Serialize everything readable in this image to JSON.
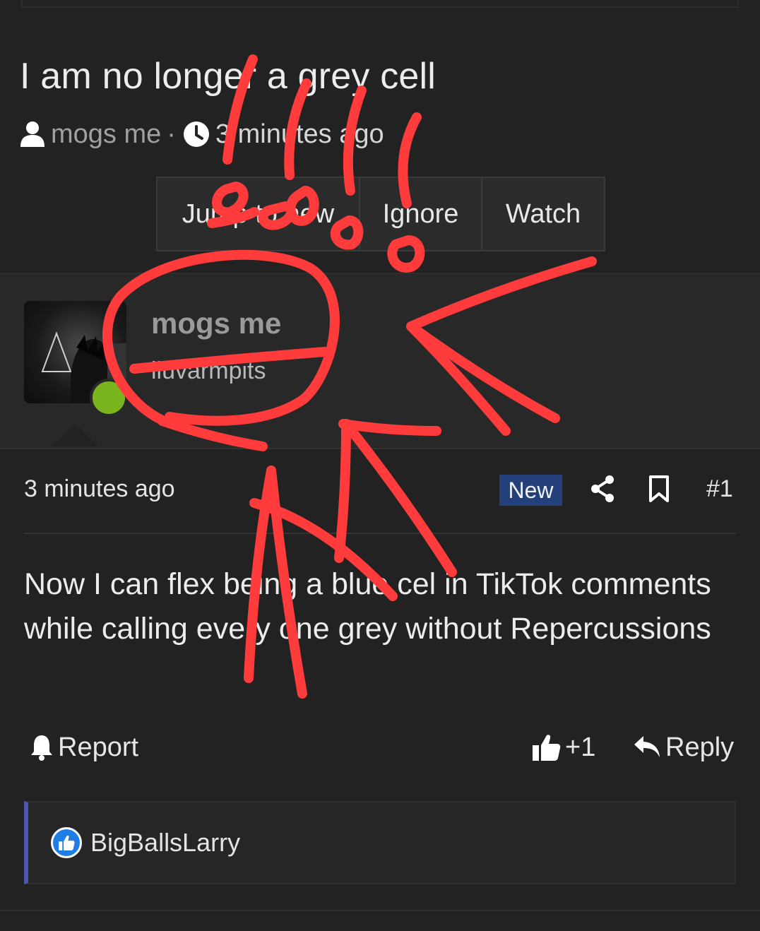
{
  "thread": {
    "title": "I am no longer a grey cell",
    "author": "mogs me",
    "separator": "·",
    "time": "3 minutes ago"
  },
  "buttons": {
    "jump": "Jump to new",
    "ignore": "Ignore",
    "watch": "Watch"
  },
  "post": {
    "username": "mogs me",
    "user_title": "iluvarmpits",
    "time": "3 minutes ago",
    "badge": "New",
    "number": "#1",
    "body": "Now I can flex being a blue cel in TikTok comments while calling every one grey without Repercussions"
  },
  "post_actions": {
    "report": "Report",
    "like_count": "+1",
    "reply": "Reply"
  },
  "reactions": {
    "user": "BigBallsLarry"
  },
  "colors": {
    "background": "#222222",
    "panel": "#282828",
    "badge_new": "#24407a",
    "online": "#7ab51d",
    "reaction_bar": "#4a56b0",
    "like_icon": "#1e7ee6",
    "scribble": "#ff3b3b"
  },
  "icons": [
    "user-icon",
    "clock-icon",
    "share-icon",
    "bookmark-icon",
    "bell-icon",
    "thumbs-up-icon",
    "reply-icon",
    "like-reaction-icon"
  ]
}
